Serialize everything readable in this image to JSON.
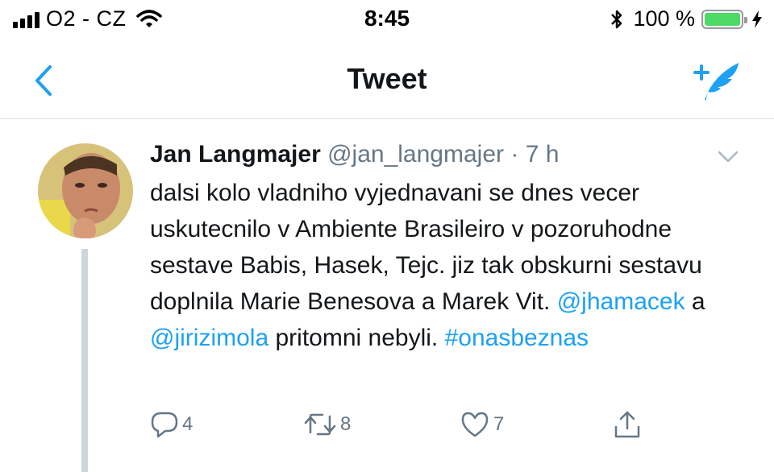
{
  "status_bar": {
    "carrier": "O2 - CZ",
    "time": "8:45",
    "battery_percent": "100 %",
    "battery_level": 1.0,
    "battery_color": "#4cd964"
  },
  "nav": {
    "title": "Tweet",
    "back_icon": "chevron-left-icon",
    "compose_icon": "compose-tweet-icon",
    "accent_color": "#1da1f2"
  },
  "tweet": {
    "author_name": "Jan Langmajer",
    "handle": "@jan_langmajer",
    "separator": "·",
    "time": "7 h",
    "text_segments": [
      {
        "text": "dalsi kolo vladniho vyjednavani se dnes vecer uskutecnilo v Ambiente Brasileiro v pozoruhodne sestave Babis, Hasek, Tejc. jiz tak obskurni sestavu doplnila Marie Benesova a Marek Vit. ",
        "type": "text"
      },
      {
        "text": "@jhamacek",
        "type": "mention"
      },
      {
        "text": " a ",
        "type": "text"
      },
      {
        "text": "@jirizimola",
        "type": "mention"
      },
      {
        "text": " pritomni nebyli. ",
        "type": "text"
      },
      {
        "text": "#onasbeznas",
        "type": "hashtag"
      }
    ],
    "actions": {
      "reply_count": "4",
      "retweet_count": "8",
      "like_count": "7"
    }
  }
}
